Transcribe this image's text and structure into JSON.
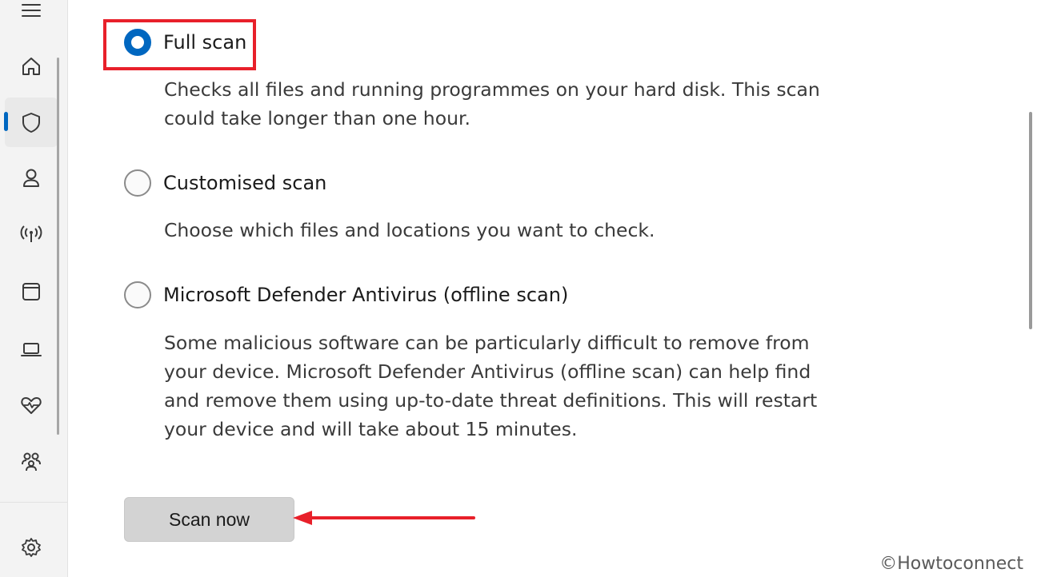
{
  "sidebar": {
    "items": [
      {
        "icon": "menu-icon"
      },
      {
        "icon": "home-icon"
      },
      {
        "icon": "shield-icon",
        "active": true
      },
      {
        "icon": "person-icon"
      },
      {
        "icon": "wireless-icon"
      },
      {
        "icon": "app-window-icon"
      },
      {
        "icon": "laptop-icon"
      },
      {
        "icon": "heart-pulse-icon"
      },
      {
        "icon": "family-icon"
      },
      {
        "icon": "settings-icon"
      }
    ]
  },
  "scan_options": [
    {
      "label": "Full scan",
      "selected": true,
      "description": "Checks all files and running programmes on your hard disk. This scan could take longer than one hour."
    },
    {
      "label": "Customised scan",
      "selected": false,
      "description": "Choose which files and locations you want to check."
    },
    {
      "label": "Microsoft Defender Antivirus (offline scan)",
      "selected": false,
      "description": "Some malicious software can be particularly difficult to remove from your device. Microsoft Defender Antivirus (offline scan) can help find and remove them using up-to-date threat definitions. This will restart your device and will take about 15 minutes."
    }
  ],
  "actions": {
    "scan_now_label": "Scan now"
  },
  "annotations": {
    "highlight_color": "#e8202a",
    "arrow_color": "#e8202a"
  },
  "watermark": "©Howtoconnect",
  "colors": {
    "accent": "#0067c0",
    "sidebar_bg": "#f3f3f3",
    "button_bg": "#d3d3d3"
  }
}
